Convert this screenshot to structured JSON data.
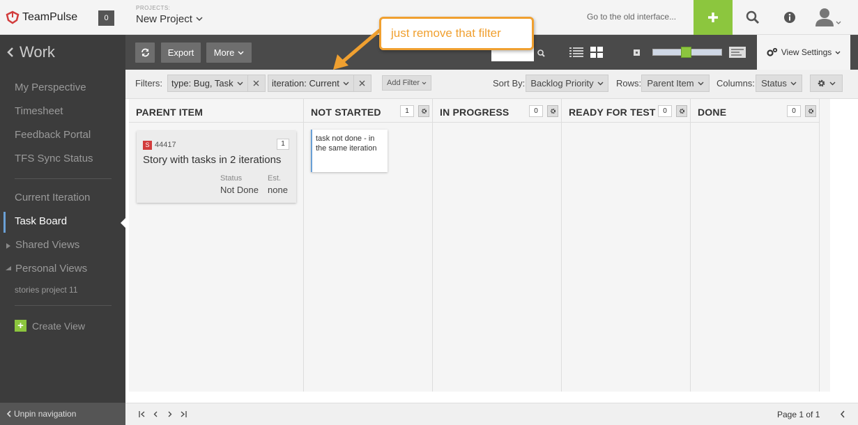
{
  "header": {
    "logo_text": "TeamPulse",
    "notification_count": "0",
    "projects_label": "PROJECTS:",
    "project_name": "New Project",
    "old_interface_link": "Go to the old interface...",
    "add_icon": "plus-icon",
    "search_icon": "search-icon",
    "info_icon": "info-icon",
    "user_icon": "user-avatar-icon"
  },
  "nav": {
    "section_title": "Work",
    "items": [
      {
        "label": "My Perspective"
      },
      {
        "label": "Timesheet"
      },
      {
        "label": "Feedback Portal"
      },
      {
        "label": "TFS Sync Status"
      },
      {
        "label": "Current Iteration"
      },
      {
        "label": "Task Board"
      },
      {
        "label": "Shared Views"
      },
      {
        "label": "Personal Views"
      }
    ],
    "personal_view_item": "stories project 11",
    "create_view": "Create View",
    "unpin": "Unpin navigation"
  },
  "toolbar": {
    "export_label": "Export",
    "more_label": "More",
    "view_settings_label": "View Settings"
  },
  "filters": {
    "label": "Filters:",
    "chips": [
      {
        "text": "type: Bug, Task"
      },
      {
        "text": "iteration: Current"
      }
    ],
    "add_filter": "Add Filter",
    "sort_label": "Sort By:",
    "sort_value": "Backlog Priority",
    "rows_label": "Rows:",
    "rows_value": "Parent Item",
    "columns_label": "Columns:",
    "columns_value": "Status"
  },
  "board": {
    "columns": [
      {
        "title": "PARENT ITEM"
      },
      {
        "title": "NOT STARTED",
        "count": "1"
      },
      {
        "title": "IN PROGRESS",
        "count": "0"
      },
      {
        "title": "READY FOR TEST",
        "count": "0"
      },
      {
        "title": "DONE",
        "count": "0"
      }
    ],
    "story": {
      "type_letter": "S",
      "id": "44417",
      "child_count": "1",
      "title": "Story with tasks in 2 iterations",
      "status_label": "Status",
      "status_value": "Not Done",
      "est_label": "Est.",
      "est_value": "none"
    },
    "task": {
      "text": "task not done - in the same iteration"
    }
  },
  "footer": {
    "page_text": "Page 1 of 1"
  },
  "annotation": {
    "callout_text": "just remove that filter",
    "color": "#f0a030"
  },
  "colors": {
    "accent_green": "#8cc63e",
    "story_red": "#d23c3c",
    "task_blue": "#6aa0d6",
    "nav_bg": "#3c3c3c",
    "toolbar_bg": "#4a4a4a"
  }
}
